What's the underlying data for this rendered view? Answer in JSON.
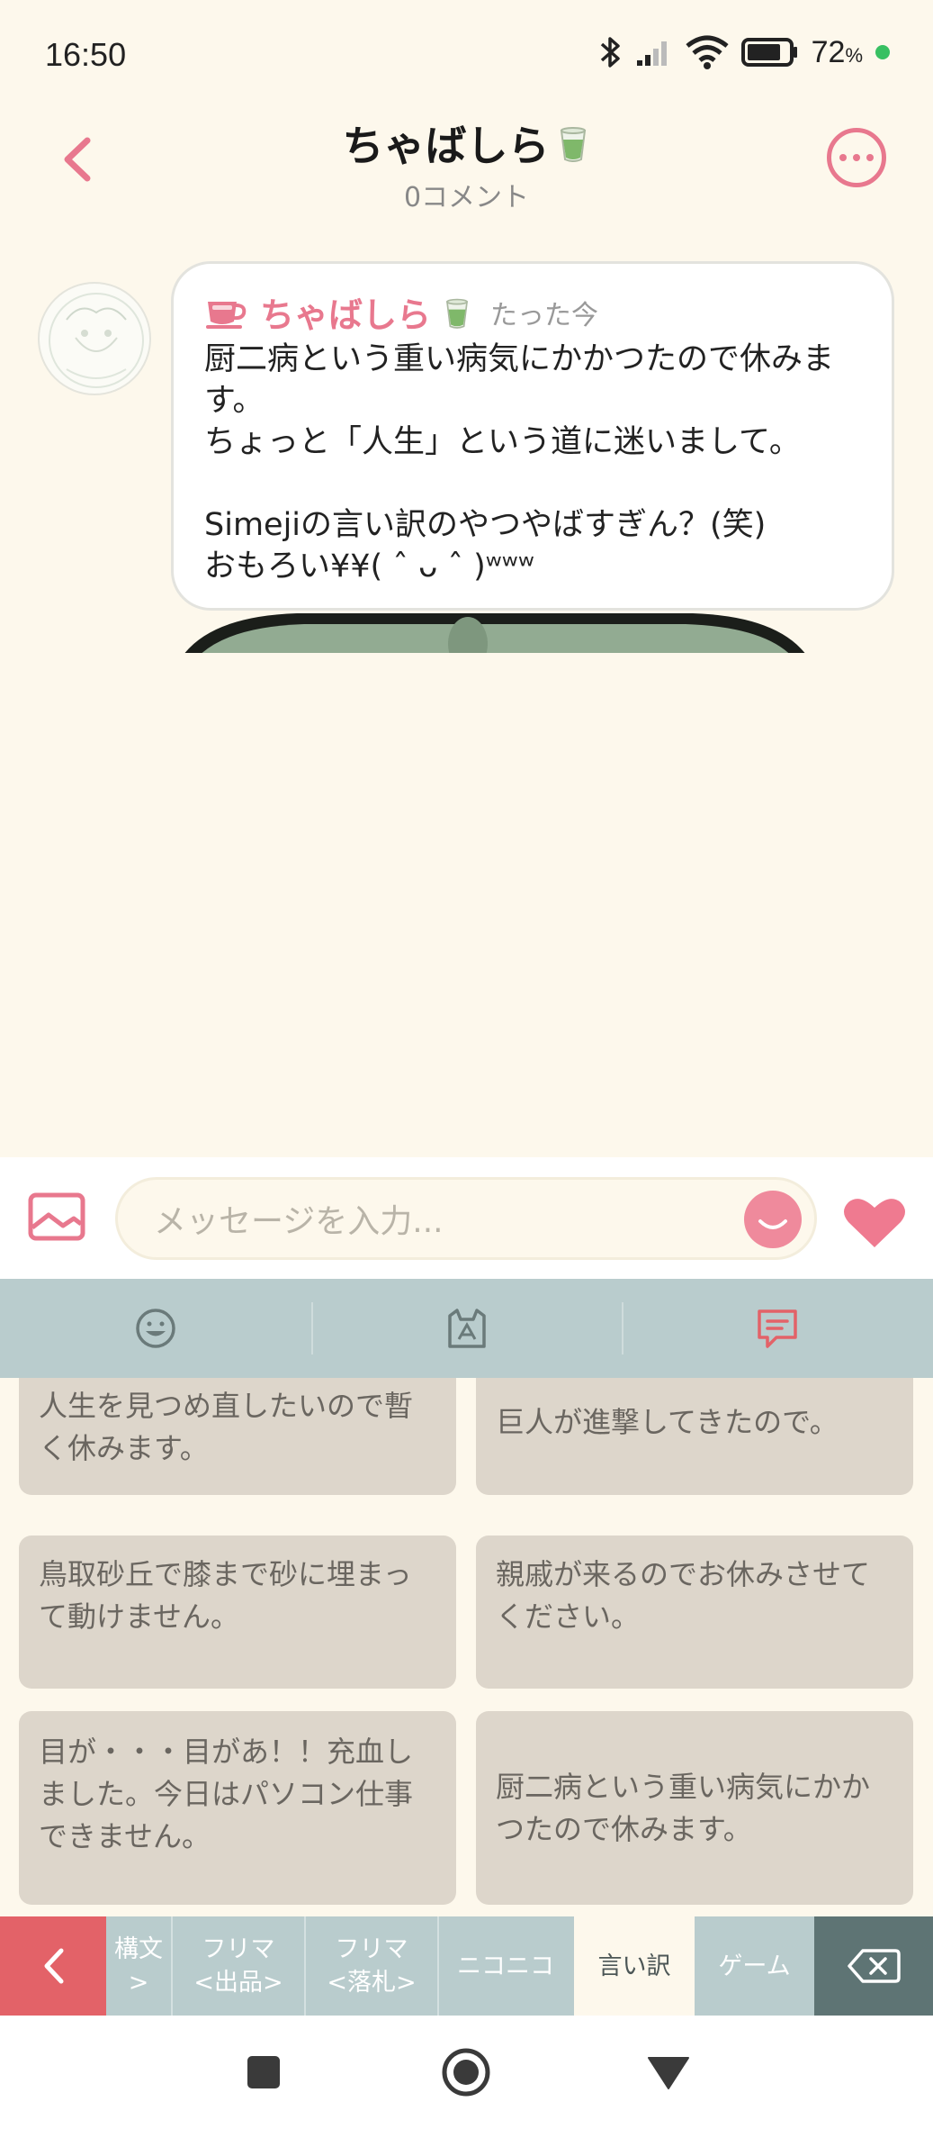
{
  "status_bar": {
    "time": "16:50",
    "battery": "72",
    "battery_unit": "%"
  },
  "header": {
    "title": "ちゃばしら",
    "title_emoji_icon": "green-tea-icon",
    "subtitle": "0コメント"
  },
  "message": {
    "author": "ちゃばしら",
    "time": "たった今",
    "text": "厨二病という重い病気にかかつたので休みます。\nちょっと「人生」という道に迷いまして。\n\nSimejiの言い訳のやつやばすぎん？(笑)\nおもろい¥¥( ˆ ᴗ ˆ )ʷʷʷ"
  },
  "input": {
    "placeholder": "メッセージを入力..."
  },
  "keyboard_tabs": [
    "emoji-face-icon",
    "kaomoji-cat-icon",
    "phrase-chat-icon"
  ],
  "phrases": [
    "人生を見つめ直したいので暫く休みます。",
    "巨人が進撃してきたので。",
    "鳥取砂丘で膝まで砂に埋まって動けません。",
    "親戚が来るのでお休みさせてください。",
    "目が・・・目があ！！充血しました。今日はパソコン仕事できません。",
    "厨二病という重い病気にかかつたので休みます。"
  ],
  "categories": {
    "c1": "構文\n>",
    "c2": "フリマ\n<出品>",
    "c3": "フリマ\n<落札>",
    "c4": "ニコニコ",
    "c5": "言い訳",
    "c6": "ゲーム"
  },
  "colors": {
    "accent_pink": "#e8788e",
    "cream_bg": "#fdf8ec",
    "keyboard_teal": "#b9cccd",
    "card_bg": "#ddd6cb",
    "delete_key": "#5e7474",
    "back_key": "#e36268"
  }
}
